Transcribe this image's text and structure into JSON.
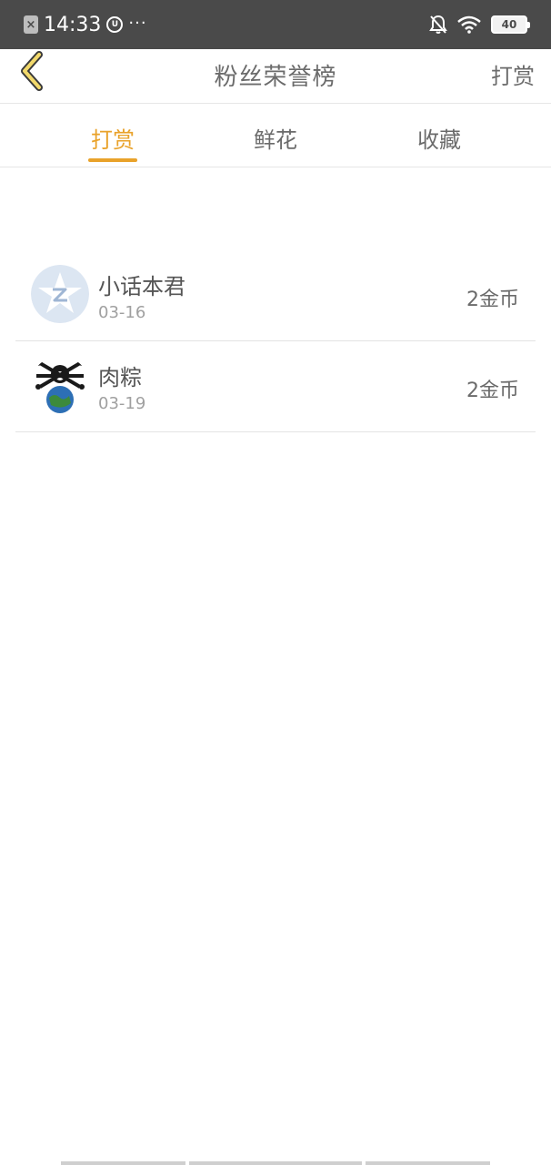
{
  "status_bar": {
    "time": "14:33",
    "dots": "···",
    "battery": "40"
  },
  "header": {
    "title": "粉丝荣誉榜",
    "action_label": "打赏"
  },
  "tabs": [
    {
      "label": "打赏",
      "active": true
    },
    {
      "label": "鲜花",
      "active": false
    },
    {
      "label": "收藏",
      "active": false
    }
  ],
  "list": [
    {
      "name": "小话本君",
      "date": "03-16",
      "amount": "2金币",
      "avatar_icon": "qzone-icon"
    },
    {
      "name": "肉粽",
      "date": "03-19",
      "amount": "2金币",
      "avatar_icon": "globe-character-avatar"
    }
  ],
  "colors": {
    "accent": "#e9a22a",
    "status_bar_bg": "#4a4a4a",
    "text_primary": "#555555",
    "text_secondary": "#a0a0a0"
  }
}
